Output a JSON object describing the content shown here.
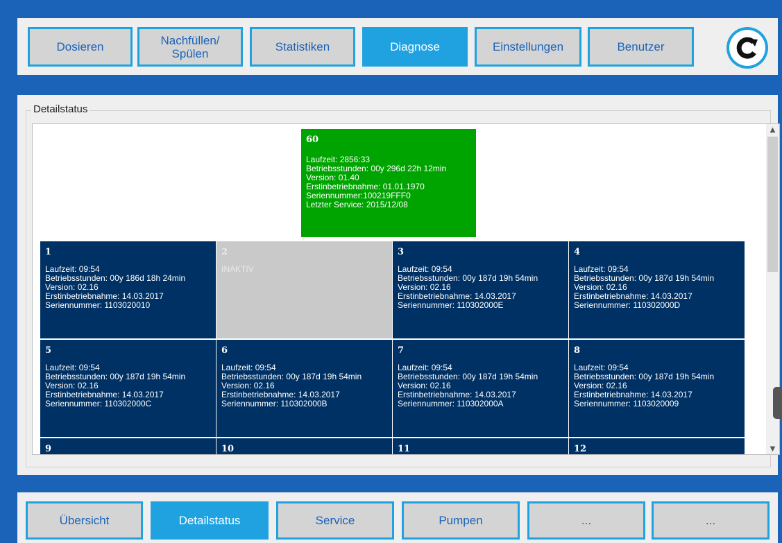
{
  "top_tabs": [
    {
      "label": "Dosieren",
      "active": false
    },
    {
      "label": "Nachfüllen/\nSpülen",
      "active": false
    },
    {
      "label": "Statistiken",
      "active": false
    },
    {
      "label": "Diagnose",
      "active": true
    },
    {
      "label": "Einstellungen",
      "active": false
    },
    {
      "label": "Benutzer",
      "active": false
    }
  ],
  "refresh_icon": "refresh-icon",
  "group_title": "Detailstatus",
  "main_tile": {
    "number": "60",
    "lines": [
      "Laufzeit: 2856:33",
      "Betriebsstunden: 00y 296d 22h 12min",
      "Version: 01.40",
      "Erstinbetriebnahme: 01.01.1970",
      "Seriennummer:100219FFF0",
      "Letzter Service: 2015/12/08"
    ]
  },
  "tiles": [
    {
      "number": "1",
      "inactive": false,
      "lines": [
        "Laufzeit: 09:54",
        "Betriebsstunden: 00y 186d 18h 24min",
        "Version: 02.16",
        "Erstinbetriebnahme: 14.03.2017",
        "Seriennummer: 1103020010"
      ]
    },
    {
      "number": "2",
      "inactive": true,
      "lines": [
        "INAKTIV"
      ]
    },
    {
      "number": "3",
      "inactive": false,
      "lines": [
        "Laufzeit: 09:54",
        "Betriebsstunden: 00y 187d 19h 54min",
        "Version: 02.16",
        "Erstinbetriebnahme: 14.03.2017",
        "Seriennummer: 110302000E"
      ]
    },
    {
      "number": "4",
      "inactive": false,
      "lines": [
        "Laufzeit: 09:54",
        "Betriebsstunden: 00y 187d 19h 54min",
        "Version: 02.16",
        "Erstinbetriebnahme: 14.03.2017",
        "Seriennummer: 110302000D"
      ]
    },
    {
      "number": "5",
      "inactive": false,
      "lines": [
        "Laufzeit: 09:54",
        "Betriebsstunden: 00y 187d 19h 54min",
        "Version: 02.16",
        "Erstinbetriebnahme: 14.03.2017",
        "Seriennummer: 110302000C"
      ]
    },
    {
      "number": "6",
      "inactive": false,
      "lines": [
        "Laufzeit: 09:54",
        "Betriebsstunden: 00y 187d 19h 54min",
        "Version: 02.16",
        "Erstinbetriebnahme: 14.03.2017",
        "Seriennummer: 110302000B"
      ]
    },
    {
      "number": "7",
      "inactive": false,
      "lines": [
        "Laufzeit: 09:54",
        "Betriebsstunden: 00y 187d 19h 54min",
        "Version: 02.16",
        "Erstinbetriebnahme: 14.03.2017",
        "Seriennummer: 110302000A"
      ]
    },
    {
      "number": "8",
      "inactive": false,
      "lines": [
        "Laufzeit: 09:54",
        "Betriebsstunden: 00y 187d 19h 54min",
        "Version: 02.16",
        "Erstinbetriebnahme: 14.03.2017",
        "Seriennummer: 1103020009"
      ]
    },
    {
      "number": "9",
      "inactive": false,
      "lines": []
    },
    {
      "number": "10",
      "inactive": false,
      "lines": []
    },
    {
      "number": "11",
      "inactive": false,
      "lines": []
    },
    {
      "number": "12",
      "inactive": false,
      "lines": []
    }
  ],
  "bottom_tabs": [
    {
      "label": "Übersicht",
      "active": false
    },
    {
      "label": "Detailstatus",
      "active": true
    },
    {
      "label": "Service",
      "active": false
    },
    {
      "label": "Pumpen",
      "active": false
    },
    {
      "label": "...",
      "active": false
    },
    {
      "label": "...",
      "active": false
    }
  ],
  "colors": {
    "background": "#1a63b8",
    "accent": "#20a2e0",
    "tile": "#003164",
    "tile_main": "#00a400",
    "tile_inactive": "#c9c9c9"
  }
}
